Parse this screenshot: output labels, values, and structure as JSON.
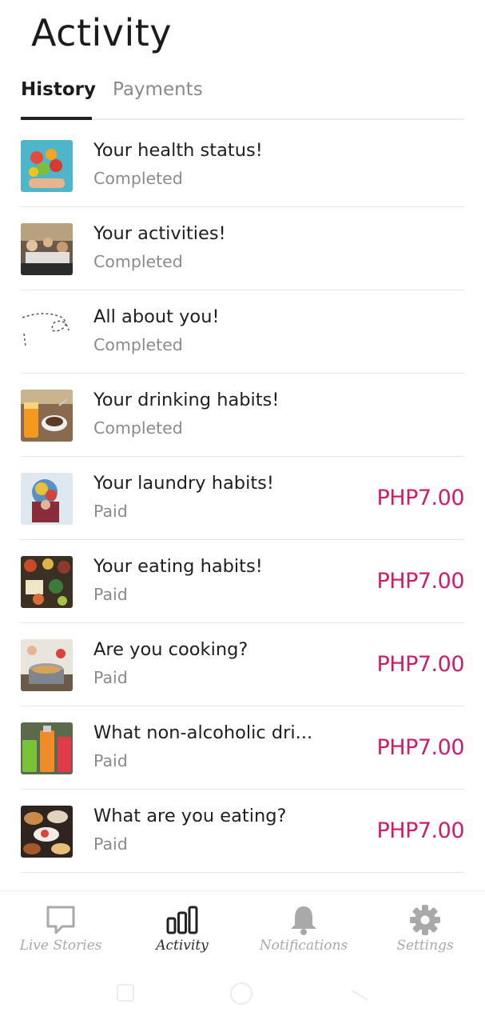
{
  "header": {
    "title": "Activity"
  },
  "tabs": [
    {
      "label": "History",
      "active": true
    },
    {
      "label": "Payments",
      "active": false
    }
  ],
  "items": [
    {
      "title": "Your health status!",
      "status": "Completed",
      "price": "",
      "thumb": "fruits"
    },
    {
      "title": "Your activities!",
      "status": "Completed",
      "price": "",
      "thumb": "people-dining"
    },
    {
      "title": "All about you!",
      "status": "Completed",
      "price": "",
      "thumb": "dotted-line"
    },
    {
      "title": "Your drinking habits!",
      "status": "Completed",
      "price": "",
      "thumb": "juice-coffee"
    },
    {
      "title": "Your laundry habits!",
      "status": "Paid",
      "price": "PHP7.00",
      "thumb": "laundry"
    },
    {
      "title": "Your eating habits!",
      "status": "Paid",
      "price": "PHP7.00",
      "thumb": "ingredients"
    },
    {
      "title": "Are you cooking?",
      "status": "Paid",
      "price": "PHP7.00",
      "thumb": "cooking-pot"
    },
    {
      "title": "What non-alcoholic dri...",
      "status": "Paid",
      "price": "PHP7.00",
      "thumb": "colorful-drinks"
    },
    {
      "title": "What are you eating?",
      "status": "Paid",
      "price": "PHP7.00",
      "thumb": "food-table"
    }
  ],
  "bottom_nav": [
    {
      "label": "Live Stories",
      "icon": "chat-bubble-icon",
      "active": false
    },
    {
      "label": "Activity",
      "icon": "bar-chart-icon",
      "active": true
    },
    {
      "label": "Notifications",
      "icon": "bell-icon",
      "active": false
    },
    {
      "label": "Settings",
      "icon": "gear-icon",
      "active": false
    }
  ],
  "colors": {
    "price": "#cc1e6a",
    "active_tab": "#1c1c1c",
    "inactive": "#8a8a8a"
  }
}
